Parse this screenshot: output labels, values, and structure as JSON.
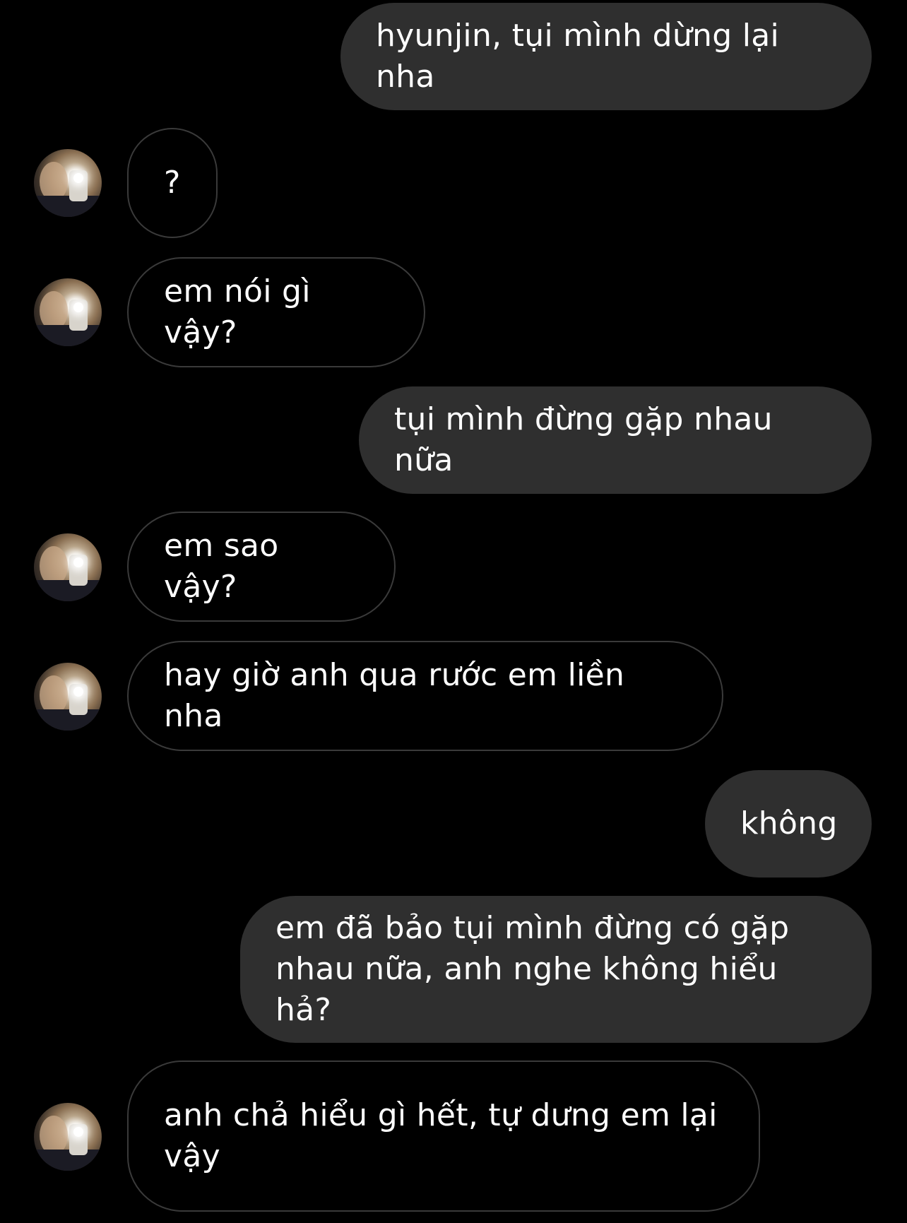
{
  "colors": {
    "background": "#000000",
    "sent_bubble": "#2f2f2f",
    "received_border": "#3a3a3a",
    "text": "#ffffff"
  },
  "messages": [
    {
      "sender": "me",
      "text": "hyunjin, tụi mình dừng lại nha"
    },
    {
      "sender": "them",
      "text": "?"
    },
    {
      "sender": "them",
      "text": "em nói gì vậy?"
    },
    {
      "sender": "me",
      "text": "tụi mình đừng gặp nhau nữa"
    },
    {
      "sender": "them",
      "text": "em sao vậy?"
    },
    {
      "sender": "them",
      "text": "hay giờ anh qua rước em liền nha"
    },
    {
      "sender": "me",
      "text": "không"
    },
    {
      "sender": "me",
      "text": "em đã bảo tụi mình đừng có gặp\nnhau nữa, anh nghe không hiểu hả?"
    },
    {
      "sender": "them",
      "text": "anh chả hiểu gì hết, tự dưng em lại\nvậy"
    }
  ]
}
